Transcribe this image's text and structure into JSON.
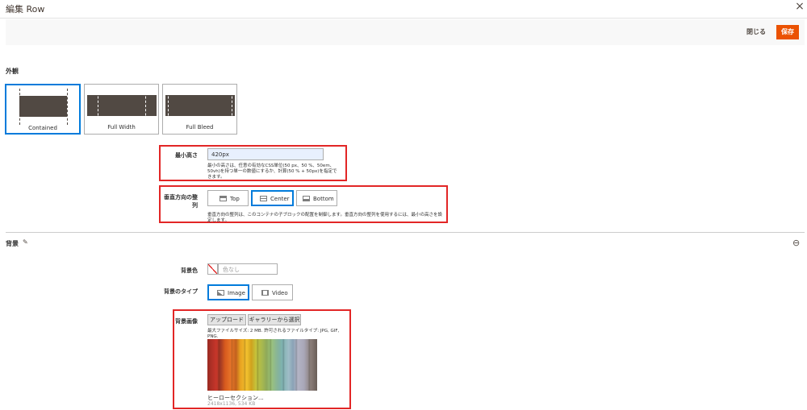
{
  "modal": {
    "title": "編集 Row",
    "close_icon": "×"
  },
  "toolbar": {
    "close_label": "閉じる",
    "save_label": "保存",
    "save_color": "#eb5202"
  },
  "appearance": {
    "heading": "外観",
    "options": [
      {
        "label": "Contained",
        "selected": true
      },
      {
        "label": "Full Width",
        "selected": false
      },
      {
        "label": "Full Bleed",
        "selected": false
      }
    ]
  },
  "min_height": {
    "label": "最小高さ",
    "value": "420px",
    "note_line1": "最小の高さは、任意の有効なCSS単位(50 px、50 %、50em、",
    "note_line2": "50vh)を持つ単一の数値にするか、計算(50 % + 50px)を指定で",
    "note_line3": "きます。"
  },
  "vertical_align": {
    "label": "垂直方向の整列",
    "options": [
      {
        "label": "Top",
        "selected": false
      },
      {
        "label": "Center",
        "selected": true
      },
      {
        "label": "Bottom",
        "selected": false
      }
    ],
    "note": "垂直方向の整列は、このコンテナの子ブロックの配置を制御します。垂直方向の整列を使用するには、最小の高さを設定します。"
  },
  "background": {
    "heading": "背景",
    "edit_icon": "✎",
    "collapse_icon": "⊖",
    "color_label": "背景色",
    "color_placeholder": "色なし",
    "type_label": "背景のタイプ",
    "type_options": [
      {
        "label": "Image",
        "selected": true,
        "icon": "image-icon"
      },
      {
        "label": "Video",
        "selected": false,
        "icon": "film-icon"
      }
    ],
    "image_label": "背景画像",
    "upload_label": "アップロード",
    "gallery_label": "ギャラリーから選択",
    "file_limits": "最大ファイルサイズ: 2 MB. 許可されるファイルタイプ: JPG, GIF, PNG.",
    "file_name": "ヒーローセクション...",
    "file_meta": "2418x1136, 534 KB"
  },
  "colors": {
    "accent": "#007bdb",
    "highlight_box": "#e22626"
  }
}
